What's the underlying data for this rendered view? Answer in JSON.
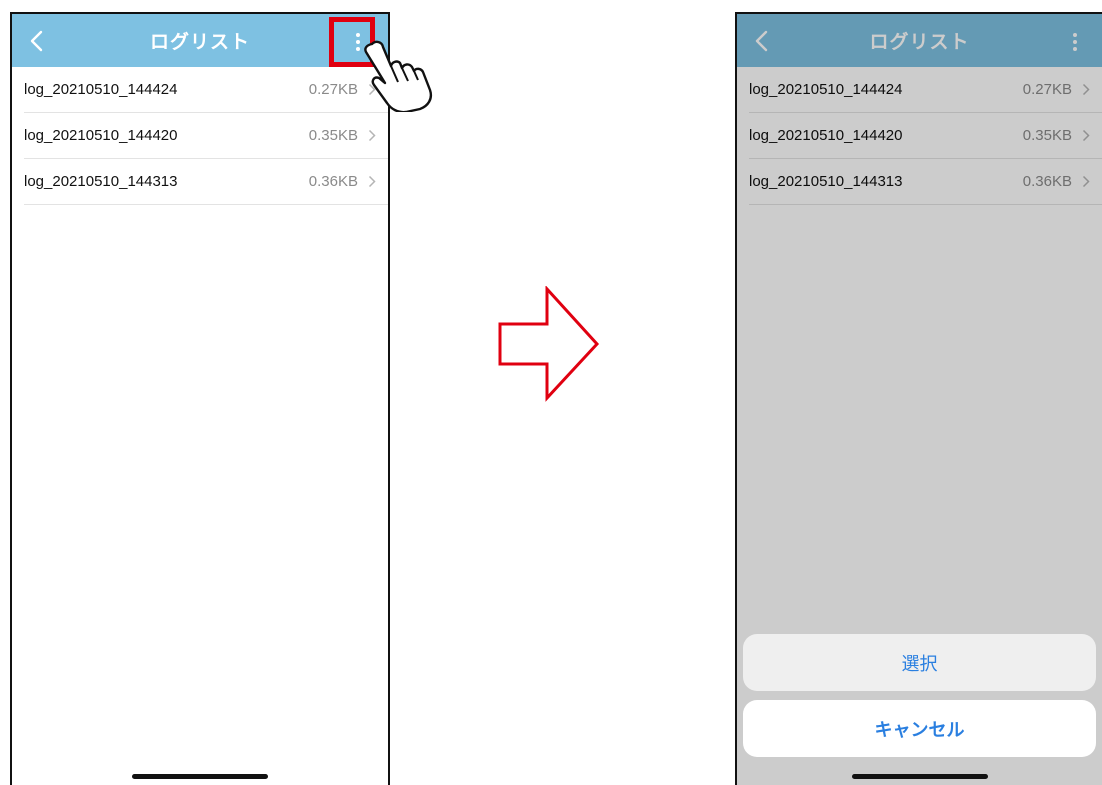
{
  "left_screen": {
    "title": "ログリスト",
    "items": [
      {
        "name": "log_20210510_144424",
        "size": "0.27KB"
      },
      {
        "name": "log_20210510_144420",
        "size": "0.35KB"
      },
      {
        "name": "log_20210510_144313",
        "size": "0.36KB"
      }
    ]
  },
  "right_screen": {
    "title": "ログリスト",
    "items": [
      {
        "name": "log_20210510_144424",
        "size": "0.27KB"
      },
      {
        "name": "log_20210510_144420",
        "size": "0.35KB"
      },
      {
        "name": "log_20210510_144313",
        "size": "0.36KB"
      }
    ],
    "action_sheet": {
      "select_label": "選択",
      "cancel_label": "キャンセル"
    }
  },
  "colors": {
    "nav_bar": "#7ec1e2",
    "action_text": "#2a7fe0",
    "highlight": "#e00010",
    "arrow": "#e00010"
  },
  "icons": {
    "back": "chevron-left-icon",
    "menu": "vertical-ellipsis-icon",
    "row": "chevron-right-icon",
    "pointer": "pointing-hand-icon",
    "transition": "right-arrow-icon"
  }
}
